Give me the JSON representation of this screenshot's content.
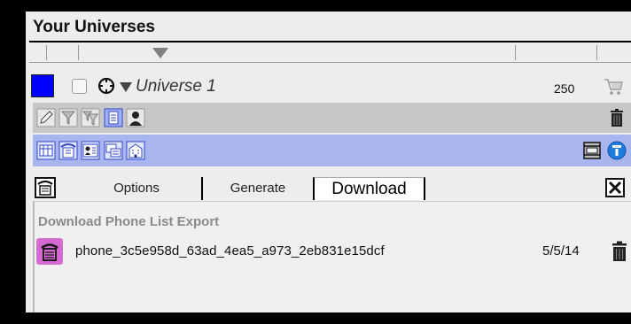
{
  "panel": {
    "title": "Your Universes"
  },
  "universe": {
    "swatch_color": "#0000ff",
    "name": "Universe 1",
    "count": "250"
  },
  "toolbar_top": {
    "icons": [
      "pencil-icon",
      "filter-icon",
      "filter-multi-icon",
      "list-icon",
      "person-icon",
      "trash-icon"
    ]
  },
  "toolbar_selected": {
    "background": "#a9b5ee",
    "icons": [
      "calendar-icon",
      "phone-book-icon",
      "address-card-icon",
      "monitor-icon",
      "building-icon",
      "film-icon",
      "info-icon"
    ]
  },
  "tabs": {
    "items": [
      "Options",
      "Generate",
      "Download"
    ],
    "active": "Download"
  },
  "download": {
    "section_title": "Download Phone List Export",
    "files": [
      {
        "name": "phone_3c5e958d_63ad_4ea5_a973_2eb831e15dcf",
        "date": "5/5/14"
      }
    ]
  }
}
